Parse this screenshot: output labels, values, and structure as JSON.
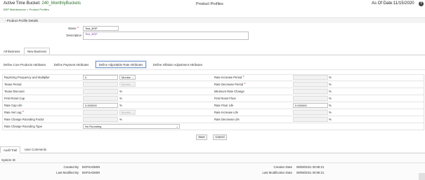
{
  "header": {
    "bucket_label": "Active Time Bucket:",
    "bucket_value": "240_MonthlyBuckets",
    "breadcrumb": "BSP Maintenance > Product Profiles",
    "page_title": "Product Profiles",
    "as_of_label": "As Of Date:",
    "as_of_value": "11/15/2020",
    "help": "?"
  },
  "details": {
    "section_title": "Product Profile Details",
    "collapse": "-",
    "name_label": "Name",
    "name_value": "Test_BSP",
    "desc_label": "Description",
    "desc_value": "Test_BSP"
  },
  "tabs": {
    "all": "All Business",
    "new": "New Business"
  },
  "subtabs": {
    "core": "Define Core Products Attributes",
    "payment": "Define Payment Attributes",
    "adjustable": "Define Adjustable Rate Attributes",
    "inflation": "Define Inflation Adjustment Attributes"
  },
  "form": {
    "repricing_label": "Repricing Frequency and Multiplier",
    "repricing_value": "0",
    "repricing_unit": "Months",
    "tease_period_label": "Tease Period",
    "tease_period_unit": "Months",
    "tease_discount_label": "Tease Discount",
    "first_reset_cap_label": "First Reset Cap",
    "rate_cap_life_label": "Rate Cap Life",
    "rate_cap_life_value": "0.000000",
    "rate_set_lag_label": "Rate Set Lag",
    "rate_set_lag_unit": "Months",
    "rounding_factor_label": "Rate Change Rounding Factor",
    "rounding_type_label": "Rate Change Rounding Type",
    "rounding_type_value": "No Rounding",
    "rate_increase_period_label": "Rate Increase Period",
    "rate_decrease_period_label": "Rate Decrease Period",
    "min_rate_change_label": "Minimum Rate Change",
    "first_reset_floor_label": "First Reset Floor",
    "rate_floor_life_label": "Rate Floor Life",
    "rate_floor_life_value": "0.000000",
    "rate_increase_life_label": "Rate Increase Life",
    "rate_decrease_life_label": "Rate Decrease Life",
    "pct": "%"
  },
  "buttons": {
    "save": "Save",
    "cancel": "Cancel"
  },
  "audit": {
    "tab_audit": "Audit Trail",
    "tab_comments": "User Comments",
    "system_id_label": "System ID",
    "created_by_label": "Created By",
    "created_by_value": "BSPSADMIN",
    "modified_by_label": "Last Modified By",
    "modified_by_value": "BSPSADMIN",
    "creation_date_label": "Creation Date",
    "creation_date_value": "08/08/2021 00:08:21",
    "modification_date_label": "Last Modification Date",
    "modification_date_value": "08/08/2021 00:08:21"
  },
  "colors": {
    "accent_green": "#2a6e2a",
    "required_red": "#c0392b",
    "active_tab_border": "#7a9cc8"
  }
}
